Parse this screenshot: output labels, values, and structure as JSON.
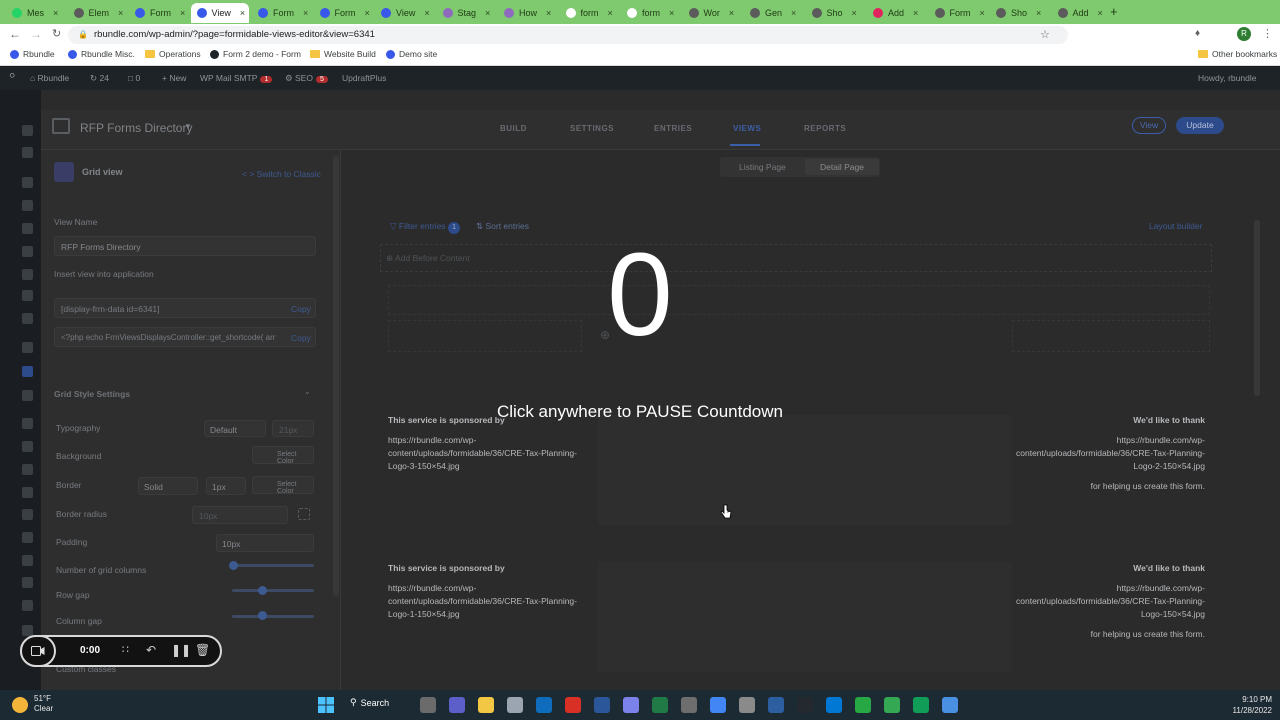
{
  "browser": {
    "tabs": [
      {
        "label": "Mes",
        "color": "#25d366"
      },
      {
        "label": "Elem",
        "color": "#5b5b5b"
      },
      {
        "label": "Form",
        "color": "#3858e9"
      },
      {
        "label": "View",
        "color": "#3858e9",
        "active": true
      },
      {
        "label": "Form",
        "color": "#3858e9"
      },
      {
        "label": "Form",
        "color": "#3858e9"
      },
      {
        "label": "View",
        "color": "#3858e9"
      },
      {
        "label": "Stag",
        "color": "#8e6bbf"
      },
      {
        "label": "How",
        "color": "#8e6bbf"
      },
      {
        "label": "form",
        "color": "#ffffff"
      },
      {
        "label": "form",
        "color": "#ffffff"
      },
      {
        "label": "Wor",
        "color": "#5b5b5b"
      },
      {
        "label": "Gen",
        "color": "#5b5b5b"
      },
      {
        "label": "Sho",
        "color": "#5b5b5b"
      },
      {
        "label": "Add",
        "color": "#e0245e"
      },
      {
        "label": "Form",
        "color": "#5b5b5b"
      },
      {
        "label": "Sho",
        "color": "#5b5b5b"
      },
      {
        "label": "Add",
        "color": "#5b5b5b"
      }
    ],
    "url": "rbundle.com/wp-admin/?page=formidable-views-editor&view=6341",
    "bookmarks": [
      "Rbundle",
      "Rbundle Misc.",
      "Operations",
      "Form 2 demo - Form",
      "Website Build",
      "Demo site"
    ],
    "other_bookmarks": "Other bookmarks"
  },
  "adminbar": {
    "site": "Rbundle",
    "updates": "24",
    "comments": "0",
    "new": "New",
    "smtp": "WP Mail SMTP",
    "smtp_badge": "1",
    "seo": "SEO",
    "seo_badge": "5",
    "updraft": "UpdraftPlus",
    "howdy": "Howdy, rbundle"
  },
  "header": {
    "title": "RFP Forms Directory",
    "tabs": [
      "BUILD",
      "SETTINGS",
      "ENTRIES",
      "VIEWS",
      "REPORTS"
    ],
    "active_tab": "VIEWS",
    "view_button": "View",
    "update_button": "Update"
  },
  "subtabs": [
    "Listing Page",
    "Detail Page"
  ],
  "panel": {
    "type_label": "Grid view",
    "switch_label": "< > Switch to Classic",
    "view_name_label": "View Name",
    "view_name_value": "RFP Forms Directory",
    "insert_label": "Insert view into application",
    "shortcode1": "[display-frm-data id=6341]",
    "shortcode2": "<?php echo FrmViewsDisplaysController::get_shortcode( arr",
    "copy": "Copy",
    "grid_style": "Grid Style Settings",
    "typography": "Typography",
    "typography_value": "Default",
    "typography_size": "21px",
    "background": "Background",
    "select_color": "Select Color",
    "border": "Border",
    "border_style": "Solid",
    "border_width": "1px",
    "border_radius": "Border radius",
    "border_radius_value": "10px",
    "padding": "Padding",
    "padding_value": "10px",
    "grid_columns": "Number of grid columns",
    "row_gap": "Row gap",
    "column_gap": "Column gap",
    "custom_classes": "Custom classes"
  },
  "canvas": {
    "filter": "Filter entries",
    "filter_count": "1",
    "sort": "Sort entries",
    "layout_builder": "Layout builder",
    "add_before": "Add Before Content",
    "sponsor_left_title": "This service is sponsored by",
    "sponsor_right_title": "We'd like to thank",
    "thanks": "for helping us create this form.",
    "row1_left_url": [
      "https://rbundle.com/wp-",
      "content/uploads/formidable/36/CRE-Tax-Planning-",
      "Logo-3-150×54.jpg"
    ],
    "row1_right_url": [
      "https://rbundle.com/wp-",
      "content/uploads/formidable/36/CRE-Tax-Planning-",
      "Logo-2-150×54.jpg"
    ],
    "row2_left_url": [
      "https://rbundle.com/wp-",
      "content/uploads/formidable/36/CRE-Tax-Planning-",
      "Logo-1-150×54.jpg"
    ],
    "row2_right_url": [
      "https://rbundle.com/wp-",
      "content/uploads/formidable/36/CRE-Tax-Planning-",
      "Logo-150×54.jpg"
    ]
  },
  "overlay": {
    "countdown": "0",
    "message": "Click anywhere to PAUSE Countdown"
  },
  "recorder": {
    "time": "0:00"
  },
  "taskbar": {
    "weather_temp": "51°F",
    "weather_cond": "Clear",
    "search": "Search",
    "time": "9:10 PM",
    "date": "11/28/2022"
  },
  "colors": {
    "tabbar": "#7fc96e",
    "wp_admin": "#1d2327",
    "accent": "#3858e9",
    "taskbar": "#1c2a33"
  }
}
